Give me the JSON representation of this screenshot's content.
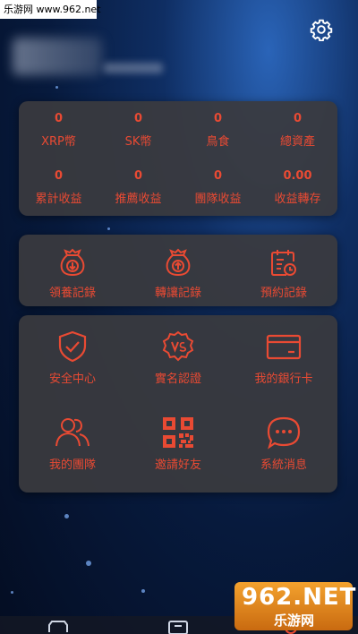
{
  "watermark": {
    "text": "乐游网 www.962.net"
  },
  "header": {
    "settings_icon": "gear-icon"
  },
  "stats": [
    {
      "value": "0",
      "label": "XRP幣"
    },
    {
      "value": "0",
      "label": "SK幣"
    },
    {
      "value": "0",
      "label": "鳥食"
    },
    {
      "value": "0",
      "label": "總資產"
    },
    {
      "value": "0",
      "label": "累計收益"
    },
    {
      "value": "0",
      "label": "推薦收益"
    },
    {
      "value": "0",
      "label": "團隊收益"
    },
    {
      "value": "0.00",
      "label": "收益轉存"
    }
  ],
  "records": [
    {
      "label": "領養記錄",
      "icon": "moneybag-down-icon"
    },
    {
      "label": "轉讓記錄",
      "icon": "moneybag-up-icon"
    },
    {
      "label": "預約記錄",
      "icon": "calendar-clock-icon"
    }
  ],
  "menu": [
    {
      "label": "安全中心",
      "icon": "shield-check-icon"
    },
    {
      "label": "實名認證",
      "icon": "verified-badge-icon"
    },
    {
      "label": "我的銀行卡",
      "icon": "bank-card-icon"
    },
    {
      "label": "我的團隊",
      "icon": "team-icon"
    },
    {
      "label": "邀請好友",
      "icon": "qr-code-icon"
    },
    {
      "label": "系統消息",
      "icon": "chat-bubble-icon"
    }
  ],
  "logo": {
    "big": "962.NET",
    "small": "乐游网"
  },
  "colors": {
    "accent": "#e94a33",
    "card": "#3a3a3e"
  }
}
